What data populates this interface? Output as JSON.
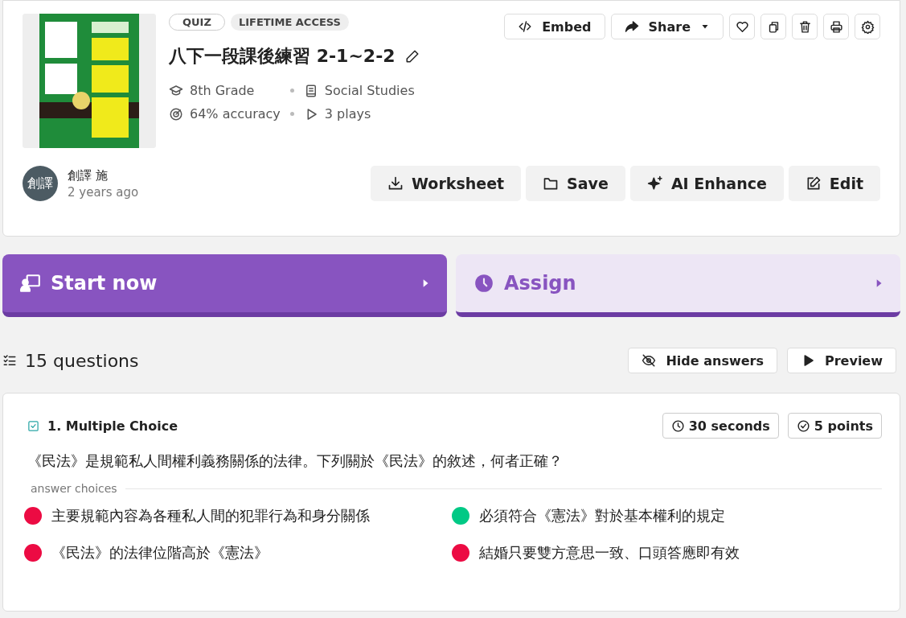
{
  "quiz": {
    "tags": [
      {
        "label": "QUIZ",
        "kind": "outline"
      },
      {
        "label": "LIFETIME ACCESS",
        "kind": "filled"
      }
    ],
    "title": "八下一段課後練習 2-1~2-2",
    "meta": [
      {
        "kind": "grade",
        "text": "8th Grade"
      },
      {
        "kind": "book",
        "text": "Social Studies"
      },
      {
        "kind": "target",
        "text": "64% accuracy"
      },
      {
        "kind": "play",
        "text": "3 plays"
      }
    ],
    "author": {
      "initials": "創譯",
      "name": "創譯 施",
      "time": "2 years ago"
    },
    "top_actions": [
      {
        "kind": "code",
        "label": "Embed"
      },
      {
        "kind": "share",
        "label": "Share",
        "dropdown": true
      },
      {
        "kind": "heart"
      },
      {
        "kind": "copy"
      },
      {
        "kind": "trash"
      },
      {
        "kind": "print"
      },
      {
        "kind": "gear"
      }
    ],
    "actions": [
      {
        "kind": "download",
        "label": "Worksheet"
      },
      {
        "kind": "folder",
        "label": "Save"
      },
      {
        "kind": "sparkle",
        "label": "AI Enhance"
      },
      {
        "kind": "edit",
        "label": "Edit"
      }
    ]
  },
  "launch": [
    {
      "kind": "primary",
      "label": "Start now"
    },
    {
      "kind": "secondary",
      "label": "Assign"
    }
  ],
  "questions_header": {
    "count": "15 questions",
    "buttons": [
      {
        "kind": "eye-off",
        "label": "Hide answers"
      },
      {
        "kind": "play",
        "label": "Preview"
      }
    ]
  },
  "question": {
    "type": "1. Multiple Choice",
    "time": "30 seconds",
    "points": "5 points",
    "text": "《民法》是規範私人間權利義務關係的法律。下列關於《民法》的敘述，何者正確？",
    "choices_label": "answer choices",
    "choices": [
      {
        "text": "主要規範內容為各種私人間的犯罪行為和身分關係",
        "correct": false
      },
      {
        "text": "必須符合《憲法》對於基本權利的規定",
        "correct": true
      },
      {
        "text": "《民法》的法律位階高於《憲法》",
        "correct": false
      },
      {
        "text": "結婚只要雙方意思一致、口頭答應即有效",
        "correct": false
      }
    ]
  }
}
